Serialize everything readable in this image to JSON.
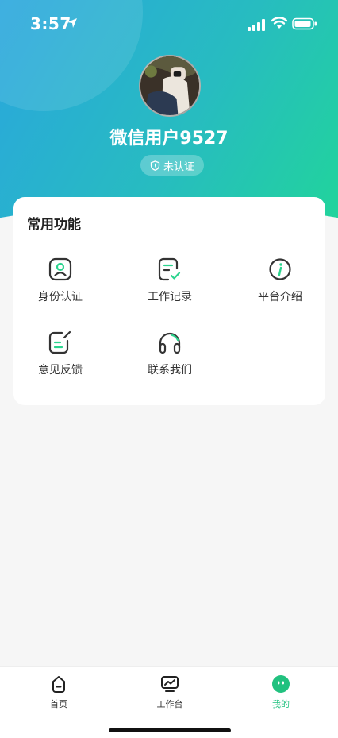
{
  "status_bar": {
    "time": "3:57"
  },
  "profile": {
    "name": "微信用户9527",
    "badge": "未认证"
  },
  "functions": {
    "title": "常用功能",
    "items": [
      {
        "label": "身份认证",
        "icon": "id-card-icon"
      },
      {
        "label": "工作记录",
        "icon": "work-record-icon"
      },
      {
        "label": "平台介绍",
        "icon": "info-icon"
      },
      {
        "label": "意见反馈",
        "icon": "feedback-icon"
      },
      {
        "label": "联系我们",
        "icon": "headset-icon"
      }
    ]
  },
  "tab_bar": {
    "items": [
      {
        "label": "首页",
        "icon": "home-icon",
        "active": false
      },
      {
        "label": "工作台",
        "icon": "workbench-icon",
        "active": false
      },
      {
        "label": "我的",
        "icon": "profile-icon",
        "active": true
      }
    ]
  },
  "colors": {
    "accent": "#21c17f",
    "header_start": "#2aa6de",
    "header_end": "#21d59a"
  }
}
